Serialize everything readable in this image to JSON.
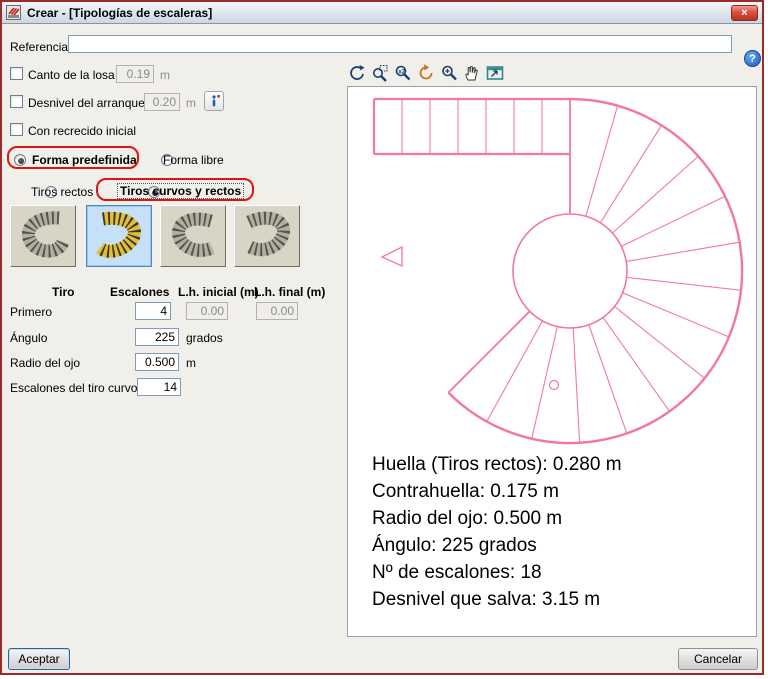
{
  "window": {
    "title": "Crear - [Tipologías de escaleras]",
    "close_glyph": "×"
  },
  "help": {
    "glyph": "?"
  },
  "form": {
    "referencia_label": "Referencia",
    "referencia_value": "",
    "canto_losa": {
      "label": "Canto de la losa",
      "value": "0.19",
      "unit": "m"
    },
    "desnivel": {
      "label": "Desnivel del arranque",
      "value": "0.20",
      "unit": "m"
    },
    "recrecido": {
      "label": "Con recrecido inicial"
    },
    "forma": {
      "predefinida": "Forma predefinida",
      "libre": "Forma libre"
    },
    "tiros": {
      "rectos": "Tiros rectos",
      "curvos": "Tiros curvos y rectos"
    },
    "table": {
      "headers": [
        "Tiro",
        "Escalones",
        "L.h. inicial (m)",
        "L.h. final (m)"
      ],
      "row_label": "Primero",
      "escalones": "4",
      "lh_inicial": "0.00",
      "lh_final": "0.00"
    },
    "angulo": {
      "label": "Ángulo",
      "value": "225",
      "unit": "grados"
    },
    "radio_ojo": {
      "label": "Radio del ojo",
      "value": "0.500",
      "unit": "m"
    },
    "escalones_curvo": {
      "label": "Escalones del tiro curvo",
      "value": "14"
    }
  },
  "state": {
    "canto_losa_checked": false,
    "desnivel_checked": false,
    "recrecido_checked": false,
    "forma_selected": "predefinida",
    "tiros_selected": "curvos",
    "selected_thumbnail": 2
  },
  "toolbar": {
    "icons": [
      "rotate-view",
      "zoom-window",
      "zoom-scale",
      "redraw",
      "zoom",
      "pan",
      "fit-window"
    ]
  },
  "preview": {
    "accent_color": "#f2789e",
    "info_lines": [
      "Huella (Tiros rectos): 0.280 m",
      "Contrahuella: 0.175 m",
      "Radio del ojo: 0.500 m",
      "Ángulo: 225 grados",
      "Nº de escalones: 18",
      "Desnivel que salva: 3.15 m"
    ]
  },
  "buttons": {
    "accept": "Aceptar",
    "cancel": "Cancelar"
  }
}
